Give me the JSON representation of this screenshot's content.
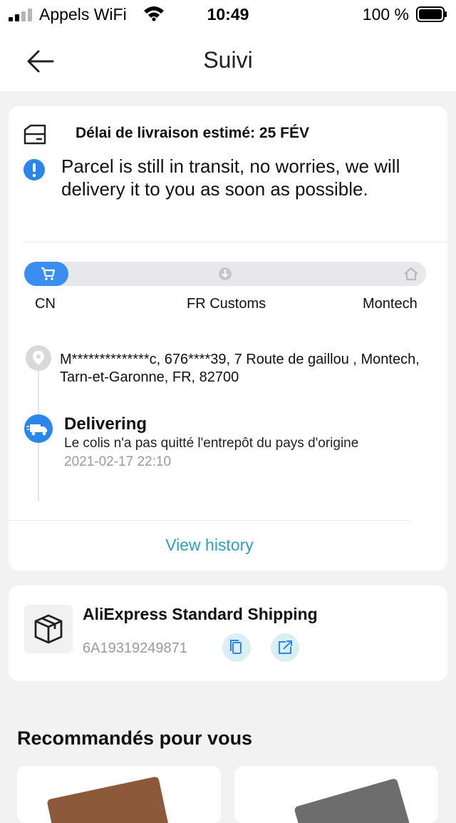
{
  "status_bar": {
    "carrier": "Appels WiFi",
    "time": "10:49",
    "battery": "100 %"
  },
  "nav": {
    "title": "Suivi",
    "back_icon": "arrow-left-icon"
  },
  "delivery": {
    "eta_label": "Délai de livraison estimé: 25 FÉV",
    "notice": "Parcel is still in transit, no worries, we will delivery it to you as soon as possible."
  },
  "progress": {
    "fraction": 0.11,
    "stops": [
      {
        "label": "CN",
        "icon": "cart-icon"
      },
      {
        "label": "FR Customs",
        "icon": "customs-icon"
      },
      {
        "label": "Montech",
        "icon": "home-icon"
      }
    ]
  },
  "address": {
    "text": "M**************c,  676****39,  7 Route de gaillou ,  Montech,  Tarn-et-Garonne,  FR,  82700"
  },
  "latest_event": {
    "title": "Delivering",
    "description": "Le colis n'a pas quitté l'entrepôt du pays d'origine",
    "date": "2021-02-17 22:10"
  },
  "history_link": "View history",
  "shipping": {
    "method": "AliExpress Standard Shipping",
    "tracking_number": "6A19319249871"
  },
  "recommendations": {
    "title": "Recommandés pour vous"
  },
  "colors": {
    "accent": "#3a8ef0",
    "link": "#2c9ec8",
    "muted": "#9a9a9a"
  }
}
